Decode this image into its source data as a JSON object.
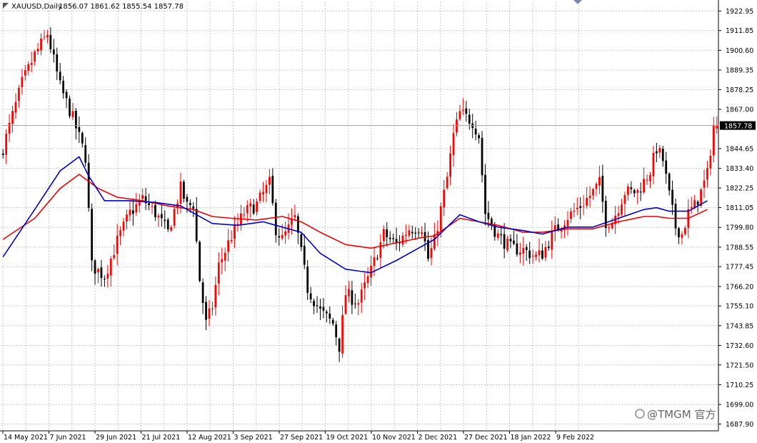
{
  "header": {
    "symbol": "XAUUSD,Daily",
    "ohlc": "1856.07 1861.62 1855.54 1857.78"
  },
  "watermark": "@TMGM 官方",
  "colors": {
    "up": "#ff0000",
    "down": "#000000",
    "ma_fast": "#0000cc",
    "ma_slow": "#ee0000",
    "grid": "#c8c8c8",
    "price_tag": "#000000"
  },
  "chart_data": {
    "type": "candlestick",
    "grid": true,
    "ylim": [
      1684.0,
      1928.0
    ],
    "yticks": [
      1922.95,
      1911.85,
      1900.6,
      1889.35,
      1878.25,
      1867.0,
      1844.65,
      1833.4,
      1822.25,
      1811.05,
      1799.8,
      1788.55,
      1777.45,
      1766.2,
      1755.1,
      1743.85,
      1732.6,
      1721.5,
      1710.25,
      1699.0,
      1687.9
    ],
    "ytick_labels": [
      "1922.95",
      "1911.85",
      "1900.60",
      "1889.35",
      "1878.25",
      "1867.00",
      "1844.65",
      "1833.40",
      "1822.25",
      "1811.05",
      "1799.80",
      "1788.55",
      "1777.45",
      "1766.20",
      "1755.10",
      "1743.85",
      "1732.60",
      "1721.50",
      "1710.25",
      "1699.00",
      "1687.90"
    ],
    "xtick_labels": [
      "14 May 2021",
      "7 Jun 2021",
      "29 Jun 2021",
      "21 Jul 2021",
      "12 Aug 2021",
      "3 Sep 2021",
      "27 Sep 2021",
      "19 Oct 2021",
      "10 Nov 2021",
      "2 Dec 2021",
      "27 Dec 2021",
      "18 Jan 2022",
      "9 Feb 2022"
    ],
    "last_price": 1857.78,
    "last_price_label": "1857.78",
    "close_path": [
      [
        0,
        1845
      ],
      [
        6,
        1882
      ],
      [
        10,
        1898
      ],
      [
        14,
        1910
      ],
      [
        18,
        1880
      ],
      [
        22,
        1862
      ],
      [
        26,
        1840
      ],
      [
        28,
        1778
      ],
      [
        32,
        1772
      ],
      [
        36,
        1792
      ],
      [
        40,
        1808
      ],
      [
        44,
        1816
      ],
      [
        48,
        1808
      ],
      [
        52,
        1797
      ],
      [
        56,
        1822
      ],
      [
        58,
        1812
      ],
      [
        60,
        1813
      ],
      [
        62,
        1770
      ],
      [
        64,
        1745
      ],
      [
        66,
        1755
      ],
      [
        68,
        1778
      ],
      [
        72,
        1795
      ],
      [
        76,
        1808
      ],
      [
        80,
        1813
      ],
      [
        84,
        1825
      ],
      [
        86,
        1799
      ],
      [
        88,
        1793
      ],
      [
        92,
        1805
      ],
      [
        96,
        1765
      ],
      [
        100,
        1752
      ],
      [
        104,
        1745
      ],
      [
        106,
        1732
      ],
      [
        108,
        1762
      ],
      [
        112,
        1757
      ],
      [
        116,
        1775
      ],
      [
        120,
        1796
      ],
      [
        124,
        1790
      ],
      [
        128,
        1799
      ],
      [
        132,
        1800
      ],
      [
        134,
        1782
      ],
      [
        136,
        1792
      ],
      [
        140,
        1828
      ],
      [
        142,
        1852
      ],
      [
        144,
        1865
      ],
      [
        148,
        1860
      ],
      [
        150,
        1852
      ],
      [
        152,
        1808
      ],
      [
        156,
        1795
      ],
      [
        160,
        1788
      ],
      [
        164,
        1787
      ],
      [
        168,
        1783
      ],
      [
        170,
        1785
      ],
      [
        174,
        1798
      ],
      [
        178,
        1806
      ],
      [
        182,
        1812
      ],
      [
        186,
        1820
      ],
      [
        188,
        1825
      ],
      [
        190,
        1803
      ],
      [
        192,
        1803
      ],
      [
        196,
        1820
      ],
      [
        200,
        1820
      ],
      [
        204,
        1832
      ],
      [
        206,
        1845
      ],
      [
        208,
        1838
      ],
      [
        210,
        1818
      ],
      [
        212,
        1800
      ],
      [
        214,
        1796
      ],
      [
        216,
        1808
      ],
      [
        218,
        1812
      ],
      [
        220,
        1820
      ],
      [
        222,
        1830
      ],
      [
        224,
        1858
      ]
    ],
    "sma_fast_path": [
      [
        0,
        1783
      ],
      [
        10,
        1810
      ],
      [
        18,
        1832
      ],
      [
        24,
        1840
      ],
      [
        27,
        1829
      ],
      [
        32,
        1815
      ],
      [
        40,
        1815
      ],
      [
        48,
        1814
      ],
      [
        56,
        1812
      ],
      [
        60,
        1808
      ],
      [
        66,
        1802
      ],
      [
        74,
        1801
      ],
      [
        82,
        1803
      ],
      [
        88,
        1800
      ],
      [
        94,
        1797
      ],
      [
        100,
        1785
      ],
      [
        108,
        1776
      ],
      [
        116,
        1774
      ],
      [
        124,
        1781
      ],
      [
        130,
        1787
      ],
      [
        136,
        1793
      ],
      [
        144,
        1807
      ],
      [
        150,
        1803
      ],
      [
        156,
        1800
      ],
      [
        164,
        1798
      ],
      [
        170,
        1796
      ],
      [
        178,
        1800
      ],
      [
        186,
        1800
      ],
      [
        194,
        1805
      ],
      [
        202,
        1810
      ],
      [
        206,
        1811
      ],
      [
        210,
        1809
      ],
      [
        216,
        1809
      ],
      [
        222,
        1815
      ]
    ],
    "sma_slow_path": [
      [
        0,
        1793
      ],
      [
        10,
        1805
      ],
      [
        18,
        1822
      ],
      [
        24,
        1830
      ],
      [
        30,
        1822
      ],
      [
        36,
        1817
      ],
      [
        44,
        1815
      ],
      [
        52,
        1812
      ],
      [
        60,
        1810
      ],
      [
        66,
        1806
      ],
      [
        72,
        1805
      ],
      [
        80,
        1804
      ],
      [
        88,
        1806
      ],
      [
        94,
        1803
      ],
      [
        100,
        1797
      ],
      [
        108,
        1790
      ],
      [
        116,
        1788
      ],
      [
        124,
        1791
      ],
      [
        132,
        1794
      ],
      [
        136,
        1795
      ],
      [
        144,
        1805
      ],
      [
        150,
        1803
      ],
      [
        156,
        1801
      ],
      [
        164,
        1797
      ],
      [
        170,
        1797
      ],
      [
        178,
        1799
      ],
      [
        186,
        1799
      ],
      [
        194,
        1803
      ],
      [
        202,
        1806
      ],
      [
        206,
        1806
      ],
      [
        210,
        1805
      ],
      [
        216,
        1805
      ],
      [
        222,
        1810
      ]
    ]
  }
}
